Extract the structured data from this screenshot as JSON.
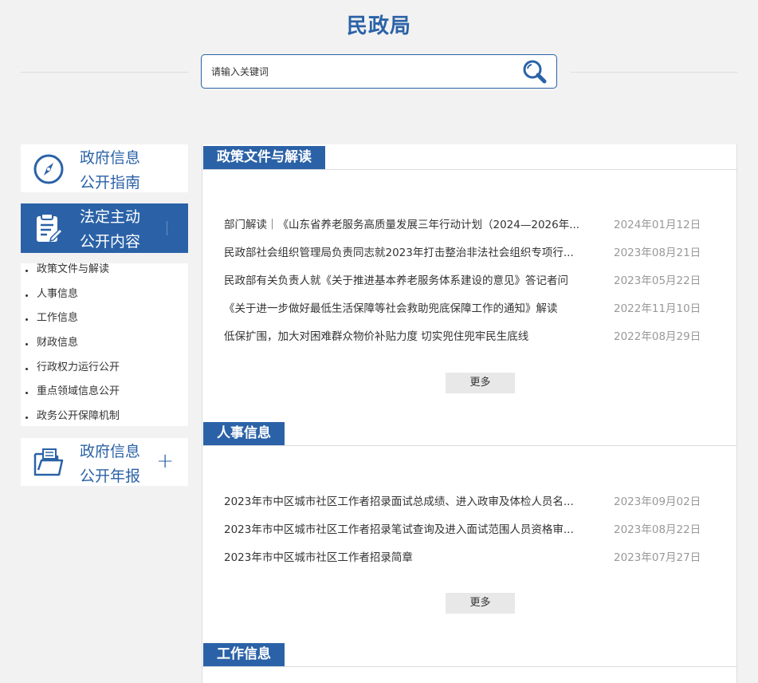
{
  "site": {
    "title": "民政局"
  },
  "search": {
    "placeholder": "请输入关键词"
  },
  "sidebar": {
    "guide": {
      "line1": "政府信息",
      "line2": "公开指南"
    },
    "content": {
      "line1": "法定主动",
      "line2": "公开内容"
    },
    "items": [
      {
        "label": "政策文件与解读"
      },
      {
        "label": "人事信息"
      },
      {
        "label": "工作信息"
      },
      {
        "label": "财政信息"
      },
      {
        "label": "行政权力运行公开"
      },
      {
        "label": "重点领域信息公开"
      },
      {
        "label": "政务公开保障机制"
      }
    ],
    "annual": {
      "line1": "政府信息",
      "line2": "公开年报",
      "expand": "+"
    }
  },
  "sections": [
    {
      "title": "政策文件与解读",
      "more": "更多",
      "items": [
        {
          "title": "部门解读｜《山东省养老服务高质量发展三年行动计划（2024—2026年...",
          "date": "2024年01月12日"
        },
        {
          "title": "民政部社会组织管理局负责同志就2023年打击整治非法社会组织专项行...",
          "date": "2023年08月21日"
        },
        {
          "title": "民政部有关负责人就《关于推进基本养老服务体系建设的意见》答记者问",
          "date": "2023年05月22日"
        },
        {
          "title": "《关于进一步做好最低生活保障等社会救助兜底保障工作的通知》解读",
          "date": "2022年11月10日"
        },
        {
          "title": "低保扩围，加大对困难群众物价补贴力度 切实兜住兜牢民生底线",
          "date": "2022年08月29日"
        }
      ]
    },
    {
      "title": "人事信息",
      "more": "更多",
      "items": [
        {
          "title": "2023年市中区城市社区工作者招录面试总成绩、进入政审及体检人员名...",
          "date": "2023年09月02日"
        },
        {
          "title": "2023年市中区城市社区工作者招录笔试查询及进入面试范围人员资格审...",
          "date": "2023年08月22日"
        },
        {
          "title": "2023年市中区城市社区工作者招录简章",
          "date": "2023年07月27日"
        }
      ]
    },
    {
      "title": "工作信息"
    }
  ],
  "colors": {
    "brand": "#2b62a7",
    "date": "#999999",
    "more_bg": "#e8e8e8"
  }
}
